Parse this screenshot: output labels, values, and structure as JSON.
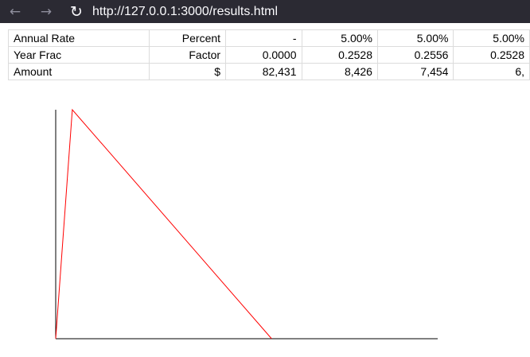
{
  "browser": {
    "url": "http://127.0.0.1:3000/results.html",
    "back_icon": "arrow-left-icon",
    "forward_icon": "arrow-right-icon",
    "reload_icon": "reload-icon"
  },
  "table": {
    "rows": [
      {
        "label": "Annual Rate",
        "unit": "Percent",
        "values": [
          "-",
          "5.00%",
          "5.00%",
          "5.00%"
        ]
      },
      {
        "label": "Year Frac",
        "unit": "Factor",
        "values": [
          "0.0000",
          "0.2528",
          "0.2556",
          "0.2528"
        ]
      },
      {
        "label": "Amount",
        "unit": "$",
        "values": [
          "82,431",
          "8,426",
          "7,454",
          "6,"
        ]
      }
    ]
  },
  "chart_data": {
    "type": "line",
    "title": "",
    "xlabel": "",
    "ylabel": "",
    "grid": false,
    "legend": "none",
    "x": [
      0,
      1,
      13
    ],
    "xlim": [
      0,
      23
    ],
    "ylim": [
      0,
      1
    ],
    "series": [
      {
        "color": "#ff0000",
        "values": [
          0,
          1,
          0
        ]
      }
    ],
    "axis_color": "#000000"
  }
}
